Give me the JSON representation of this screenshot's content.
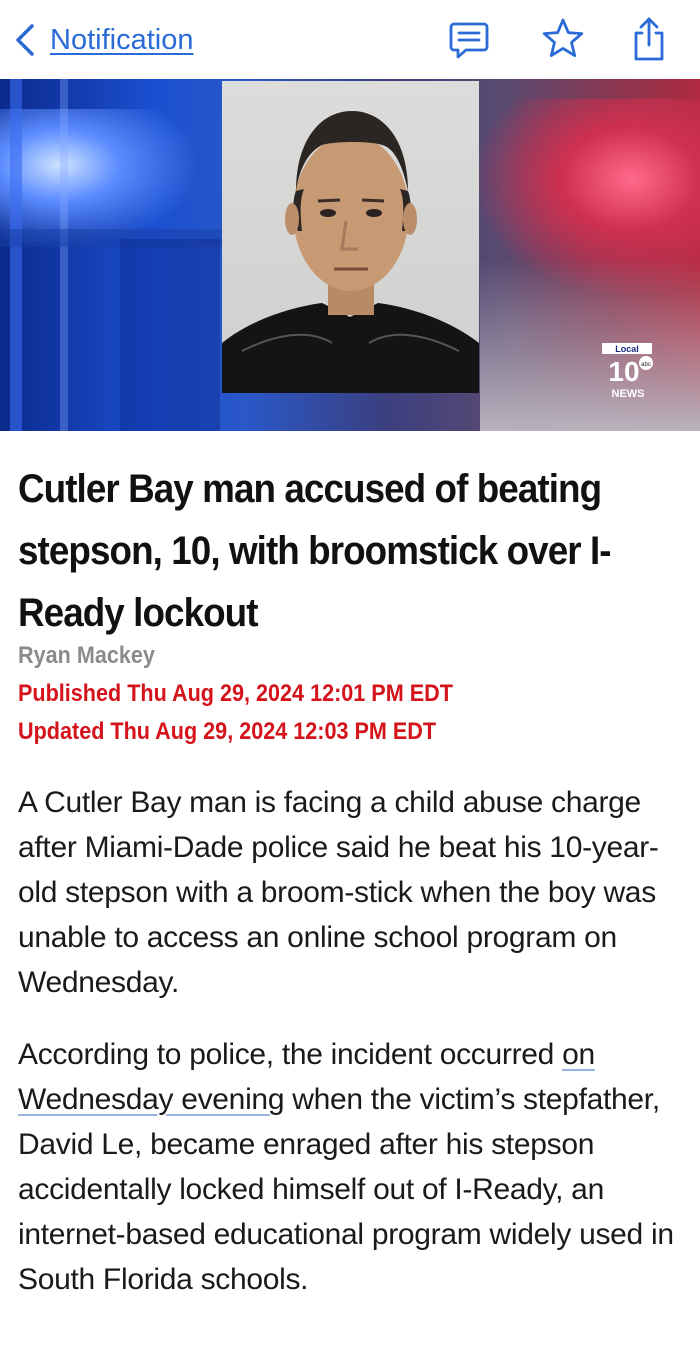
{
  "nav": {
    "back_label": "Notification",
    "icons": [
      "chevron-left-icon",
      "message-icon",
      "star-icon",
      "share-icon"
    ],
    "accent_color": "#2a6bd8"
  },
  "hero": {
    "logo_top": "Local",
    "logo_number": "10",
    "logo_network": "abc",
    "logo_bottom": "NEWS"
  },
  "article": {
    "headline": "Cutler Bay man accused of beating stepson, 10, with broomstick over I-Ready lockout",
    "author": "Ryan Mackey",
    "published": "Published Thu Aug 29, 2024 12:01 PM EDT",
    "updated": "Updated Thu Aug 29, 2024 12:03 PM EDT",
    "meta_color": "#d4131b",
    "paragraph1": "A Cutler Bay man is facing a child abuse charge after Miami-Dade police said he beat his 10-year-old stepson with a broom-stick when the boy was unable to access an online school program on Wednesday.",
    "paragraph2_before": "According to police, the incident occurred ",
    "paragraph2_link": "on Wednesday evening",
    "paragraph2_after": " when the victim’s stepfather, David Le, became enraged after his stepson accidentally locked himself out of I-Ready, an internet-based educational program widely used in South Florida schools."
  }
}
